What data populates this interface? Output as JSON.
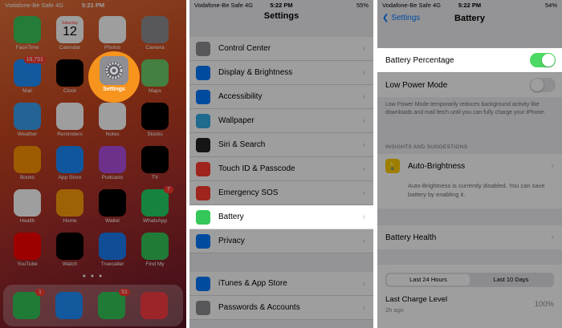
{
  "panel1": {
    "status": {
      "carrier": "Vodafone-Be Safe  4G",
      "time": "5:21 PM"
    },
    "apps": [
      {
        "label": "FaceTime",
        "icon": "facetime-icon",
        "color": "#3dc95b"
      },
      {
        "label": "Calendar",
        "icon": "calendar-icon",
        "color": "#ffffff",
        "day": "Saturday",
        "date": "12"
      },
      {
        "label": "Photos",
        "icon": "photos-icon",
        "color": "#ffffff"
      },
      {
        "label": "Camera",
        "icon": "camera-icon",
        "color": "#8e8e93"
      },
      {
        "label": "Mail",
        "icon": "mail-icon",
        "color": "#1e90ff",
        "badge": "18,751"
      },
      {
        "label": "Clock",
        "icon": "clock-icon",
        "color": "#000000"
      },
      {
        "label": "Maps",
        "icon": "maps-icon",
        "color": "#6fcf6a"
      },
      {
        "label": "Weather",
        "icon": "weather-icon",
        "color": "#3ba0f0"
      },
      {
        "label": "Reminders",
        "icon": "reminders-icon",
        "color": "#ffffff"
      },
      {
        "label": "Notes",
        "icon": "notes-icon",
        "color": "#ffffff"
      },
      {
        "label": "Stocks",
        "icon": "stocks-icon",
        "color": "#000000"
      },
      {
        "label": "Books",
        "icon": "books-icon",
        "color": "#ff9500"
      },
      {
        "label": "App Store",
        "icon": "app-store-icon",
        "color": "#1a8cff"
      },
      {
        "label": "Podcasts",
        "icon": "podcasts-icon",
        "color": "#b150e2"
      },
      {
        "label": "TV",
        "icon": "tv-icon",
        "color": "#000000"
      },
      {
        "label": "Health",
        "icon": "health-icon",
        "color": "#ffffff"
      },
      {
        "label": "Home",
        "icon": "home-icon",
        "color": "#ff9f0a"
      },
      {
        "label": "Wallet",
        "icon": "wallet-icon",
        "color": "#000000"
      },
      {
        "label": "WhatsApp",
        "icon": "whatsapp-icon",
        "color": "#25d366",
        "badge": "7"
      },
      {
        "label": "YouTube",
        "icon": "youtube-icon",
        "color": "#ff0000"
      },
      {
        "label": "Watch",
        "icon": "watch-icon",
        "color": "#000000"
      },
      {
        "label": "Truecaller",
        "icon": "truecaller-icon",
        "color": "#1c7cf4"
      },
      {
        "label": "Find My",
        "icon": "find-my-icon",
        "color": "#34c759"
      }
    ],
    "settings_label": "Settings",
    "dock": [
      {
        "icon": "phone-icon",
        "color": "#34c759",
        "badge": "1"
      },
      {
        "icon": "safari-icon",
        "color": "#1e90ff"
      },
      {
        "icon": "messages-icon",
        "color": "#34c759",
        "badge": "51"
      },
      {
        "icon": "music-icon",
        "color": "#fc3c44"
      }
    ]
  },
  "panel2": {
    "status": {
      "carrier": "Vodafone-Be Safe  4G",
      "time": "5:22 PM",
      "battery": "55%"
    },
    "title": "Settings",
    "rows": [
      {
        "label": "Control Center",
        "icon": "control-center-icon",
        "color": "#8e8e93"
      },
      {
        "label": "Display & Brightness",
        "icon": "display-icon",
        "color": "#007aff"
      },
      {
        "label": "Accessibility",
        "icon": "accessibility-icon",
        "color": "#007aff"
      },
      {
        "label": "Wallpaper",
        "icon": "wallpaper-icon",
        "color": "#32ade6"
      },
      {
        "label": "Siri & Search",
        "icon": "siri-icon",
        "color": "#222222"
      },
      {
        "label": "Touch ID & Passcode",
        "icon": "touch-id-icon",
        "color": "#ff3b30"
      },
      {
        "label": "Emergency SOS",
        "icon": "sos-icon",
        "color": "#ff3b30"
      },
      {
        "label": "Battery",
        "icon": "battery-icon",
        "color": "#34c759"
      },
      {
        "label": "Privacy",
        "icon": "privacy-icon",
        "color": "#007aff"
      },
      {
        "label": "iTunes & App Store",
        "icon": "itunes-icon",
        "color": "#007aff"
      },
      {
        "label": "Passwords & Accounts",
        "icon": "passwords-icon",
        "color": "#8e8e93"
      }
    ]
  },
  "panel3": {
    "status": {
      "carrier": "Vodafone-Be Safe  4G",
      "time": "5:22 PM",
      "battery": "54%"
    },
    "back_label": "Settings",
    "title": "Battery",
    "battery_percentage": {
      "label": "Battery Percentage",
      "on": true
    },
    "low_power": {
      "label": "Low Power Mode",
      "on": false,
      "note": "Low Power Mode temporarily reduces background activity like downloads and mail fetch until you can fully charge your iPhone."
    },
    "insights_header": "INSIGHTS AND SUGGESTIONS",
    "auto_brightness": {
      "label": "Auto-Brightness",
      "note": "Auto-Brightness is currently disabled. You can save battery by enabling it."
    },
    "battery_health": "Battery Health",
    "segments": [
      "Last 24 Hours",
      "Last 10 Days"
    ],
    "last_charge": {
      "label": "Last Charge Level",
      "ago": "2h ago",
      "value": "100%"
    }
  }
}
